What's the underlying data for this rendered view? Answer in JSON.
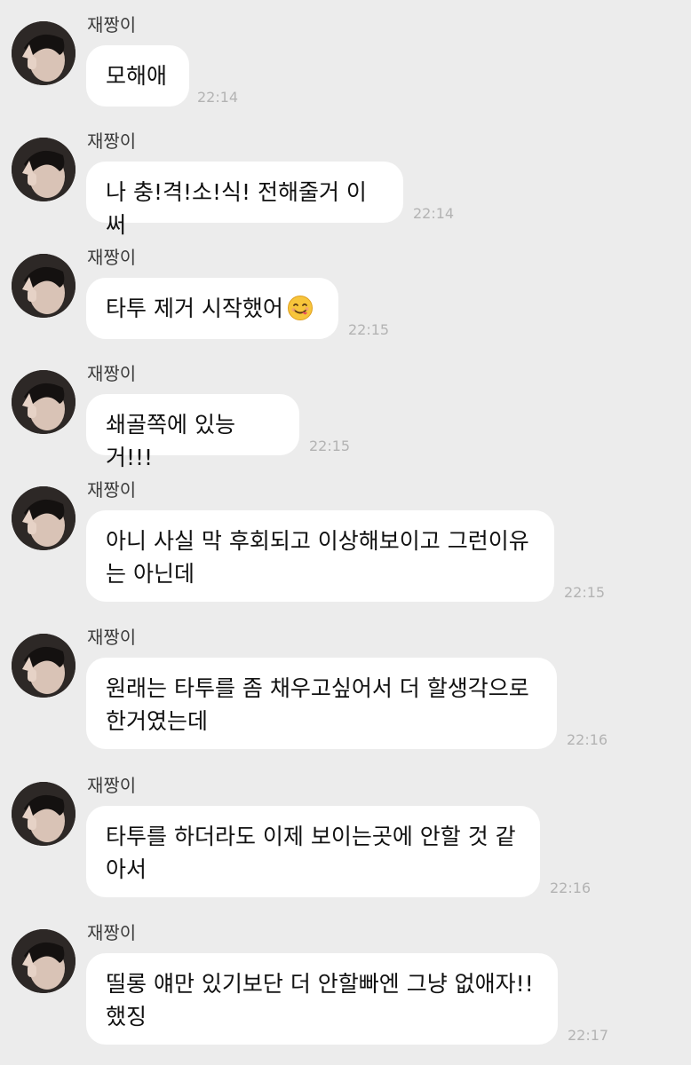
{
  "messages": [
    {
      "sender": "재짱이",
      "text": "모해애",
      "time": "22:14"
    },
    {
      "sender": "재짱이",
      "text": "나 충!격!소!식! 전해줄거 이써",
      "time": "22:14"
    },
    {
      "sender": "재짱이",
      "text": "타투 제거 시작했어",
      "emoji": "yum-face-icon",
      "time": "22:15"
    },
    {
      "sender": "재짱이",
      "text": "쇄골쪽에 있능거!!!",
      "time": "22:15"
    },
    {
      "sender": "재짱이",
      "text": "아니 사실 막 후회되고 이상해보이고 그런이유\n는 아닌데",
      "time": "22:15"
    },
    {
      "sender": "재짱이",
      "text": "원래는 타투를 좀 채우고싶어서 더 할생각으로\n한거였는데",
      "time": "22:16"
    },
    {
      "sender": "재짱이",
      "text": "타투를 하더라도 이제 보이는곳에 안할 것 같\n아서",
      "time": "22:16"
    },
    {
      "sender": "재짱이",
      "text": "띨롱 얘만 있기보단 더 안할빠엔 그냥 없애자!!\n했징",
      "time": "22:17"
    }
  ],
  "colors": {
    "background": "#ececec",
    "bubble": "#ffffff",
    "time": "#b3b3b3"
  }
}
